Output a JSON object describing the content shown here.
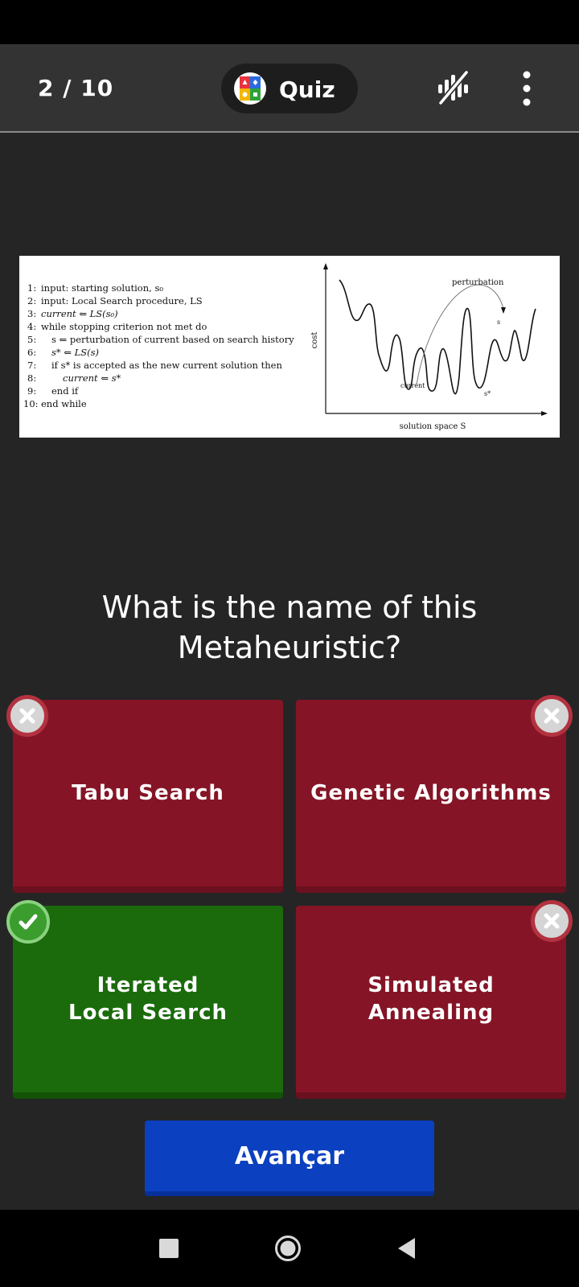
{
  "header": {
    "progress": "2 / 10",
    "mode_label": "Quiz",
    "icons": [
      "quiz-logo-icon",
      "sound-off-icon",
      "more-vertical-icon"
    ]
  },
  "figure": {
    "algorithm_lines": [
      {
        "n": "1:",
        "text": "input: starting solution, s₀"
      },
      {
        "n": "2:",
        "text": "input: Local Search procedure, LS"
      },
      {
        "n": "3:",
        "text": "current ⇐ LS(s₀)"
      },
      {
        "n": "4:",
        "text": "while stopping criterion not met do"
      },
      {
        "n": "5:",
        "text": "s ⇐ perturbation of current based on search history"
      },
      {
        "n": "6:",
        "text": "s* ⇐ LS(s)"
      },
      {
        "n": "7:",
        "text": "if s* is accepted as the new current solution then"
      },
      {
        "n": "8:",
        "text": "current ⇐ s*"
      },
      {
        "n": "9:",
        "text": "end if"
      },
      {
        "n": "10:",
        "text": "end while"
      }
    ],
    "plot": {
      "ylabel": "cost",
      "xlabel": "solution space S",
      "perturbation_label": "perturbation",
      "current_label": "current",
      "s_label": "s",
      "s_star_label": "s*"
    }
  },
  "question": "What is the name of this Metaheuristic?",
  "answers": [
    {
      "label": "Tabu Search",
      "status": "wrong"
    },
    {
      "label": "Genetic Algorithms",
      "status": "wrong"
    },
    {
      "label": "Iterated Local Search",
      "status": "correct"
    },
    {
      "label": "Simulated Annealing",
      "status": "wrong"
    }
  ],
  "next_label": "Avançar",
  "colors": {
    "wrong": "#851526",
    "correct": "#1b6b0c",
    "next": "#0b40c0",
    "background": "#252525",
    "topbar": "#333333"
  },
  "navbar_icons": [
    "recents-square-icon",
    "home-circle-icon",
    "back-triangle-icon"
  ]
}
